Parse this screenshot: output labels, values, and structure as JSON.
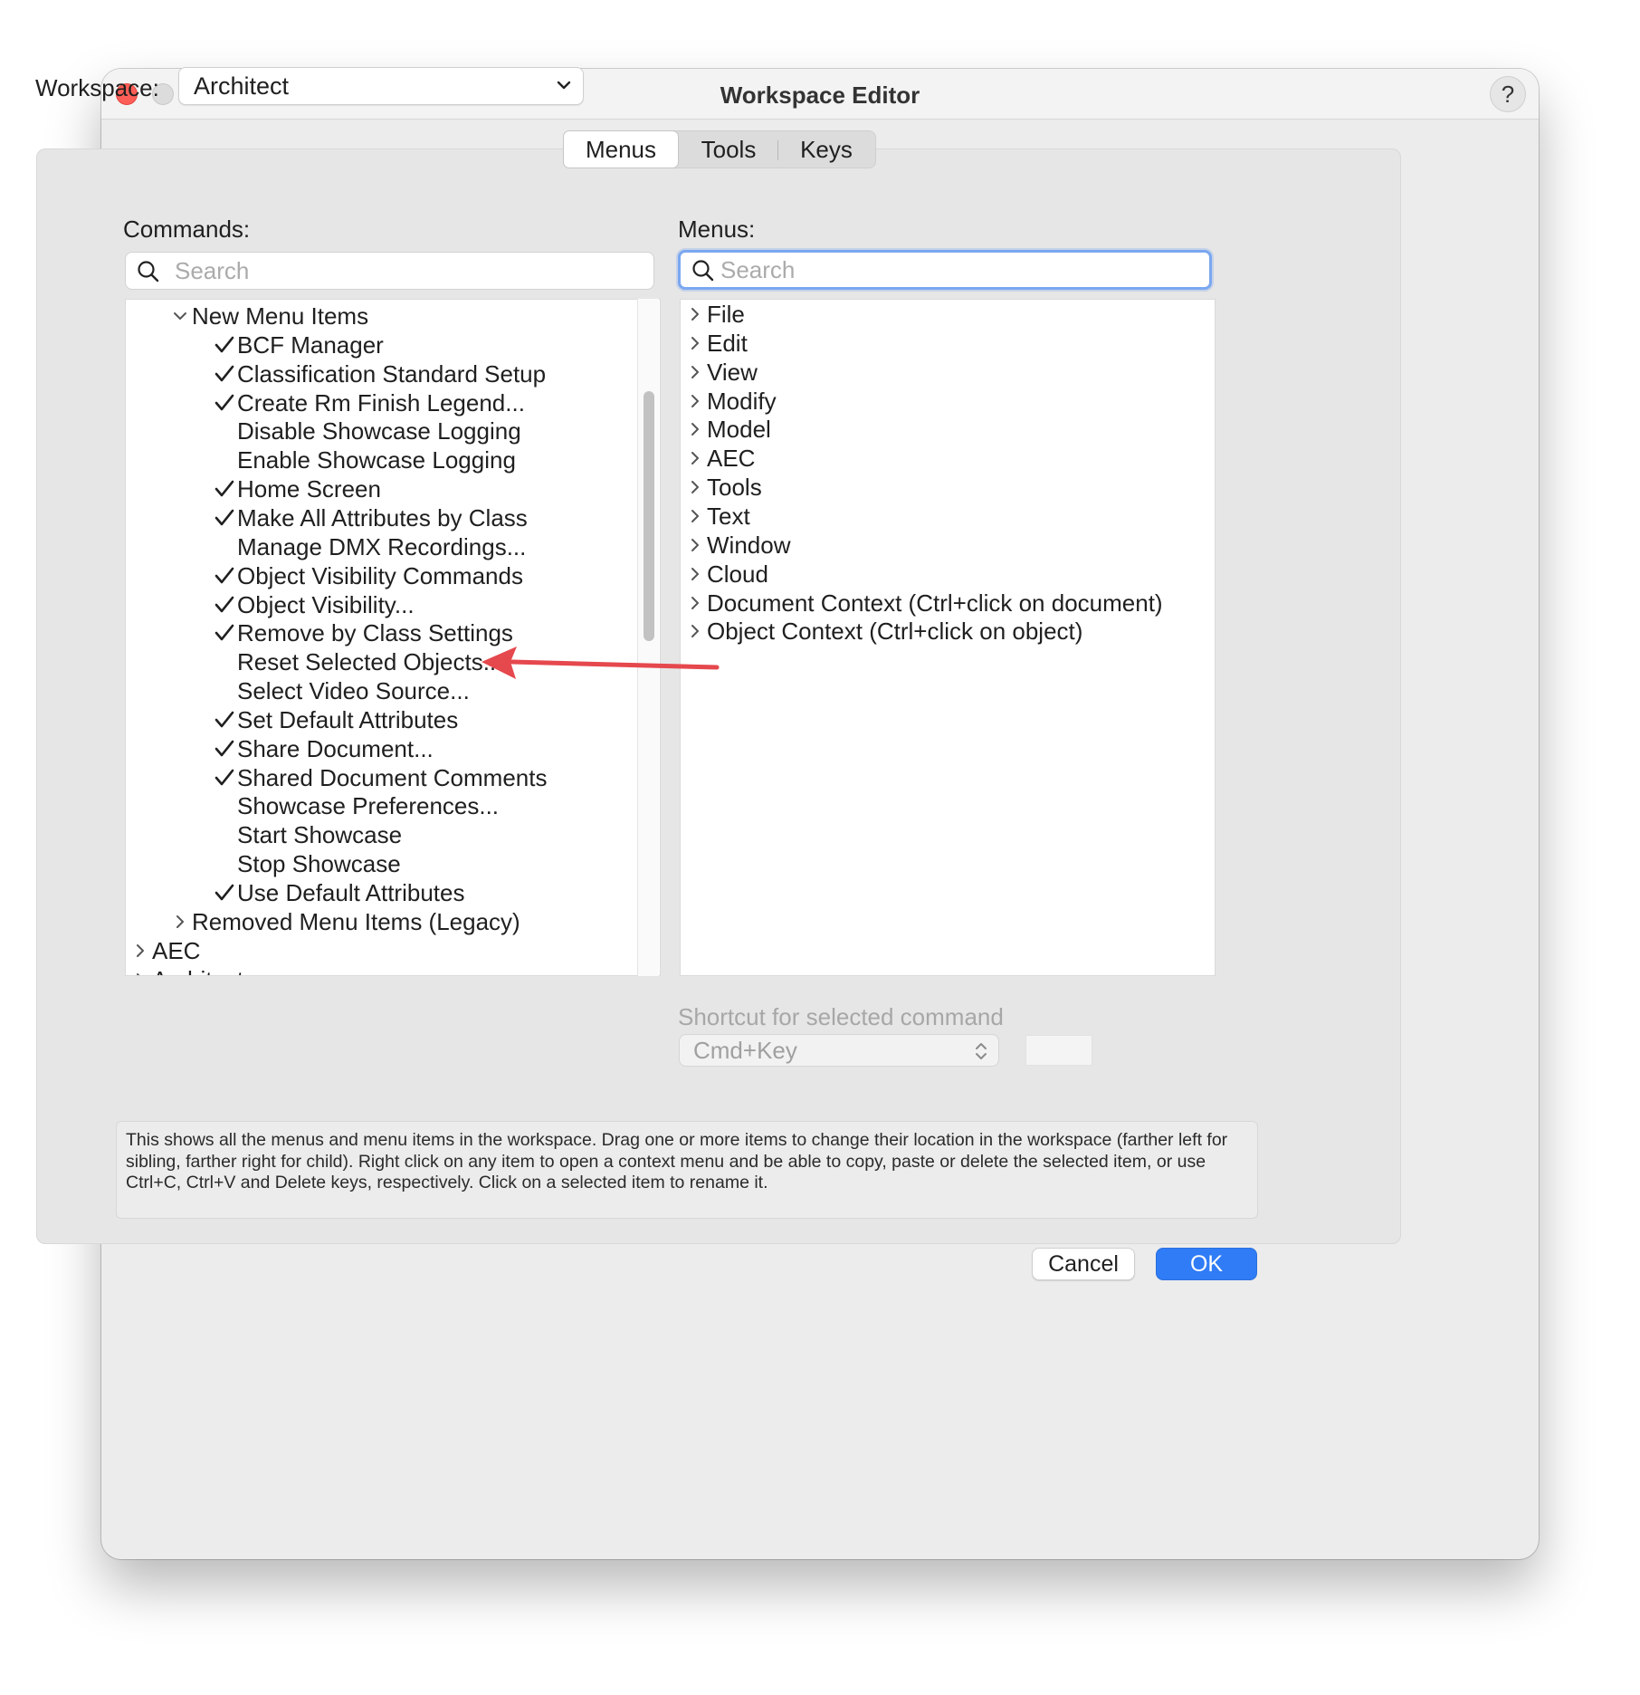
{
  "window": {
    "title": "Workspace Editor",
    "help_label": "?"
  },
  "workspace": {
    "label": "Workspace:",
    "selected": "Architect"
  },
  "tabs": [
    "Menus",
    "Tools",
    "Keys"
  ],
  "commands": {
    "label": "Commands:",
    "search_placeholder": "Search",
    "tree": [
      {
        "label": "New Menu Items",
        "level": 1,
        "expander": "expanded",
        "checked": false
      },
      {
        "label": "BCF Manager",
        "level": 2,
        "expander": "none",
        "checked": true
      },
      {
        "label": "Classification Standard Setup",
        "level": 2,
        "expander": "none",
        "checked": true
      },
      {
        "label": "Create Rm Finish Legend...",
        "level": 2,
        "expander": "none",
        "checked": true
      },
      {
        "label": "Disable Showcase Logging",
        "level": 2,
        "expander": "none",
        "checked": false
      },
      {
        "label": "Enable Showcase Logging",
        "level": 2,
        "expander": "none",
        "checked": false
      },
      {
        "label": "Home Screen",
        "level": 2,
        "expander": "none",
        "checked": true
      },
      {
        "label": "Make All Attributes by Class",
        "level": 2,
        "expander": "none",
        "checked": true
      },
      {
        "label": "Manage DMX Recordings...",
        "level": 2,
        "expander": "none",
        "checked": false
      },
      {
        "label": "Object Visibility Commands",
        "level": 2,
        "expander": "none",
        "checked": true
      },
      {
        "label": "Object Visibility...",
        "level": 2,
        "expander": "none",
        "checked": true
      },
      {
        "label": "Remove by Class Settings",
        "level": 2,
        "expander": "none",
        "checked": true
      },
      {
        "label": "Reset Selected Objects...",
        "level": 2,
        "expander": "none",
        "checked": false
      },
      {
        "label": "Select Video Source...",
        "level": 2,
        "expander": "none",
        "checked": false
      },
      {
        "label": "Set Default Attributes",
        "level": 2,
        "expander": "none",
        "checked": true
      },
      {
        "label": "Share Document...",
        "level": 2,
        "expander": "none",
        "checked": true
      },
      {
        "label": "Shared Document Comments",
        "level": 2,
        "expander": "none",
        "checked": true
      },
      {
        "label": "Showcase Preferences...",
        "level": 2,
        "expander": "none",
        "checked": false
      },
      {
        "label": "Start Showcase",
        "level": 2,
        "expander": "none",
        "checked": false
      },
      {
        "label": "Stop Showcase",
        "level": 2,
        "expander": "none",
        "checked": false
      },
      {
        "label": "Use Default Attributes",
        "level": 2,
        "expander": "none",
        "checked": true
      },
      {
        "label": "Removed Menu Items (Legacy)",
        "level": 1,
        "expander": "collapsed",
        "checked": false
      },
      {
        "label": "AEC",
        "level": 0,
        "expander": "collapsed",
        "checked": false
      },
      {
        "label": "Architect",
        "level": 0,
        "expander": "collapsed",
        "checked": false
      }
    ]
  },
  "menus": {
    "label": "Menus:",
    "search_placeholder": "Search",
    "items": [
      "File",
      "Edit",
      "View",
      "Modify",
      "Model",
      "AEC",
      "Tools",
      "Text",
      "Window",
      "Cloud",
      "Document Context (Ctrl+click on document)",
      "Object Context (Ctrl+click on object)"
    ]
  },
  "shortcut": {
    "label": "Shortcut for selected command",
    "modifier": "Cmd+Key",
    "key": ""
  },
  "info_text": "This shows all the menus and menu items in the workspace. Drag one or more items to change their location in the workspace (farther left for sibling, farther right for child). Right click on any item to open a context menu and be able to copy, paste or delete the selected item, or use Ctrl+C, Ctrl+V and Delete keys, respectively. Click on a selected item to rename it.",
  "buttons": {
    "cancel": "Cancel",
    "ok": "OK"
  },
  "colors": {
    "accent": "#2f7cf6",
    "focus_ring": "#7aa7f0",
    "annotation_arrow": "#e5484d",
    "close": "#ff5f57",
    "maximize": "#28c840"
  },
  "icons": {
    "search": "magnifier-icon",
    "expanded": "chevron-down-icon",
    "collapsed": "chevron-right-icon",
    "checked": "checkmark-icon",
    "select": "chevron-down-icon",
    "stepper": "up-down-chevron-icon",
    "annotation": "red-arrow-icon"
  }
}
